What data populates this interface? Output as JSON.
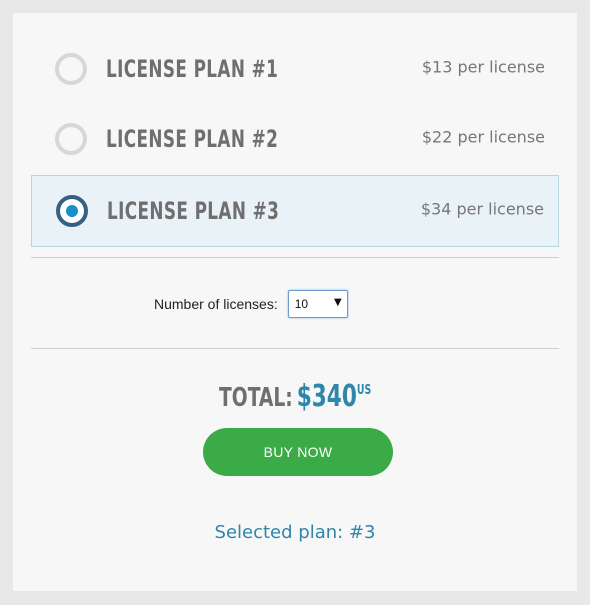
{
  "plans": [
    {
      "name": "LICENSE PLAN #1",
      "price": "$13 per license",
      "selected": false
    },
    {
      "name": "LICENSE PLAN #2",
      "price": "$22 per license",
      "selected": false
    },
    {
      "name": "LICENSE PLAN #3",
      "price": "$34 per license",
      "selected": true
    }
  ],
  "licenses": {
    "label": "Number of licenses:",
    "value": "10"
  },
  "total": {
    "label": "TOTAL:",
    "amount": "$340",
    "currency": "US"
  },
  "buy_button": {
    "label": "BUY NOW"
  },
  "selected_plan": {
    "text": "Selected plan: #3"
  },
  "colors": {
    "accent": "#2e86ab",
    "button_green": "#3aab46",
    "selected_radio_ring": "#356084",
    "selected_radio_dot": "#1a8ec7",
    "selected_row_bg": "#e9f3f7"
  },
  "icons": [
    "radio-unchecked-icon",
    "radio-checked-icon",
    "dropdown-arrow-icon"
  ]
}
